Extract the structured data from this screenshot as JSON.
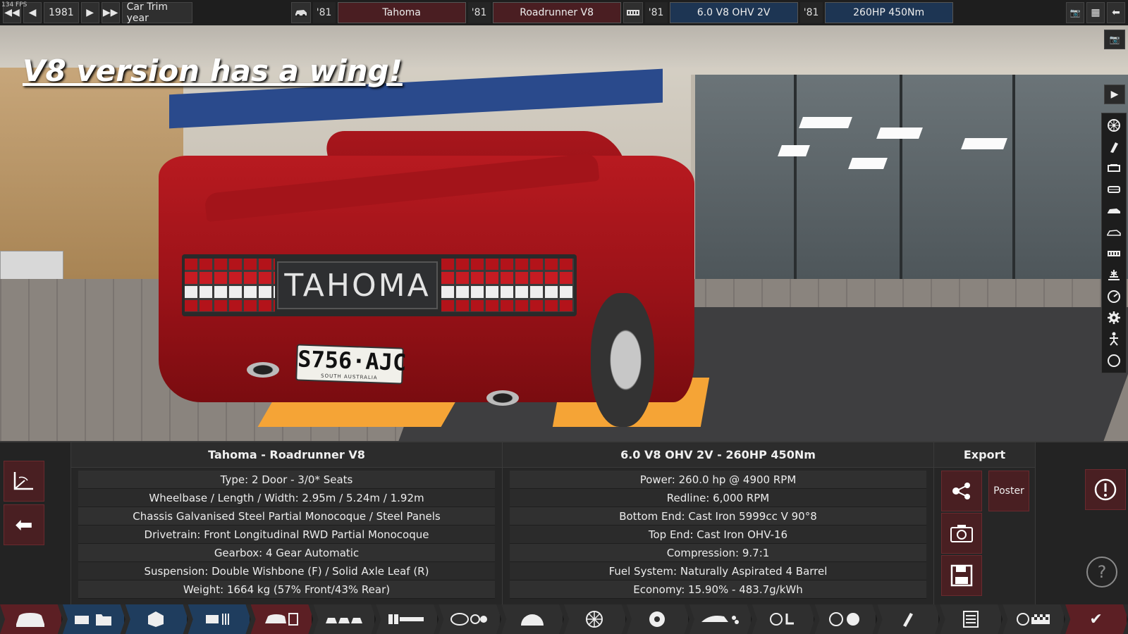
{
  "fps": "134 FPS",
  "overlay_title": "V8 version has a wing!",
  "topbar": {
    "year": "1981",
    "trim_year_label": "Car Trim year",
    "model_year": "'81",
    "model": "Tahoma",
    "trim_year": "'81",
    "trim": "Roadrunner V8",
    "engine_year": "'81",
    "engine": "6.0 V8 OHV 2V",
    "variant_year": "'81",
    "variant": "260HP 450Nm"
  },
  "car": {
    "badge": "TAHOMA",
    "plate": "S756·AJC",
    "plate_region": "SOUTH AUSTRALIA"
  },
  "panel": {
    "car_title": "Tahoma - Roadrunner V8",
    "car_rows": [
      "Type: 2 Door - 3/0* Seats",
      "Wheelbase / Length / Width: 2.95m / 5.24m / 1.92m",
      "Chassis Galvanised Steel Partial Monocoque / Steel Panels",
      "Drivetrain: Front Longitudinal RWD Partial Monocoque",
      "Gearbox: 4 Gear Automatic",
      "Suspension: Double Wishbone (F) / Solid Axle Leaf (R)",
      "Weight: 1664 kg (57% Front/43% Rear)"
    ],
    "engine_title": "6.0 V8 OHV 2V - 260HP 450Nm",
    "engine_rows": [
      "Power: 260.0 hp @ 4900 RPM",
      "Redline:  6,000 RPM",
      "Bottom End: Cast Iron 5999cc V 90°8",
      "Top End: Cast Iron OHV-16",
      "Compression: 9.7:1",
      "Fuel System: Naturally Aspirated 4 Barrel",
      "Economy: 15.90% - 483.7g/kWh"
    ],
    "export_title": "Export",
    "poster_label": "Poster"
  },
  "icons": {
    "top_first": "◀◀",
    "top_prev": "◀",
    "top_next": "▶",
    "top_last": "▶▶",
    "camera": "📷",
    "menu": "▦",
    "back": "⬅",
    "play": "▶",
    "share": "⚯",
    "photo": "📷",
    "save": "💾",
    "warning": "!",
    "help": "?",
    "axis": "⟀",
    "arrow_left": "⬅",
    "check": "✔"
  },
  "colors": {
    "accent_red": "#5c1f24",
    "accent_blue": "#1f3d5e"
  }
}
